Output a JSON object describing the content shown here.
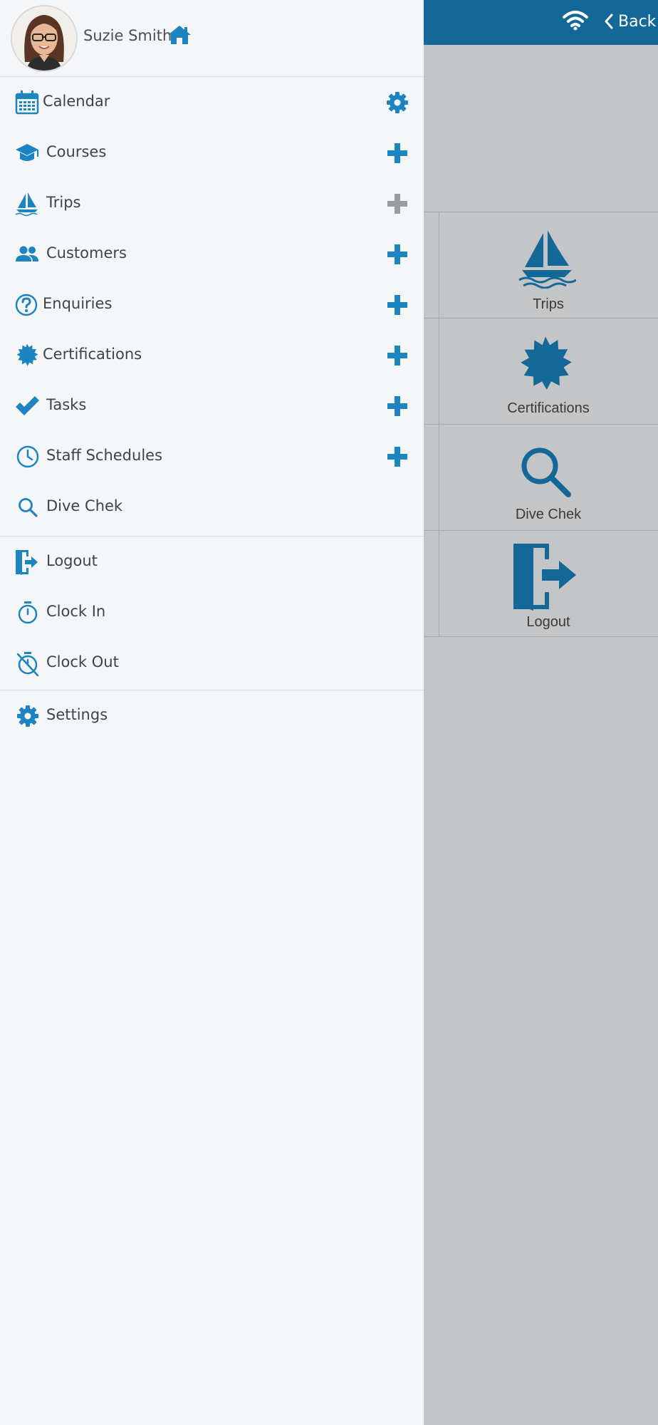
{
  "header": {
    "back_label": "Back"
  },
  "user": {
    "name": "Suzie Smith"
  },
  "menu": {
    "calendar": "Calendar",
    "courses": "Courses",
    "trips": "Trips",
    "customers": "Customers",
    "enquiries": "Enquiries",
    "certifications": "Certifications",
    "tasks": "Tasks",
    "staff_schedules": "Staff Schedules",
    "dive_chek": "Dive Chek",
    "logout": "Logout",
    "clock_in": "Clock In",
    "clock_out": "Clock Out",
    "settings": "Settings"
  },
  "tiles": {
    "trips": "Trips",
    "certifications": "Certifications",
    "dive_chek": "Dive Chek",
    "logout": "Logout"
  },
  "colors": {
    "brand": "#146898",
    "accent": "#1b84c1",
    "disabled": "#9a9c9f",
    "drawer_bg": "#f4f6f8",
    "overlay_bg": "#c4c5c7"
  }
}
